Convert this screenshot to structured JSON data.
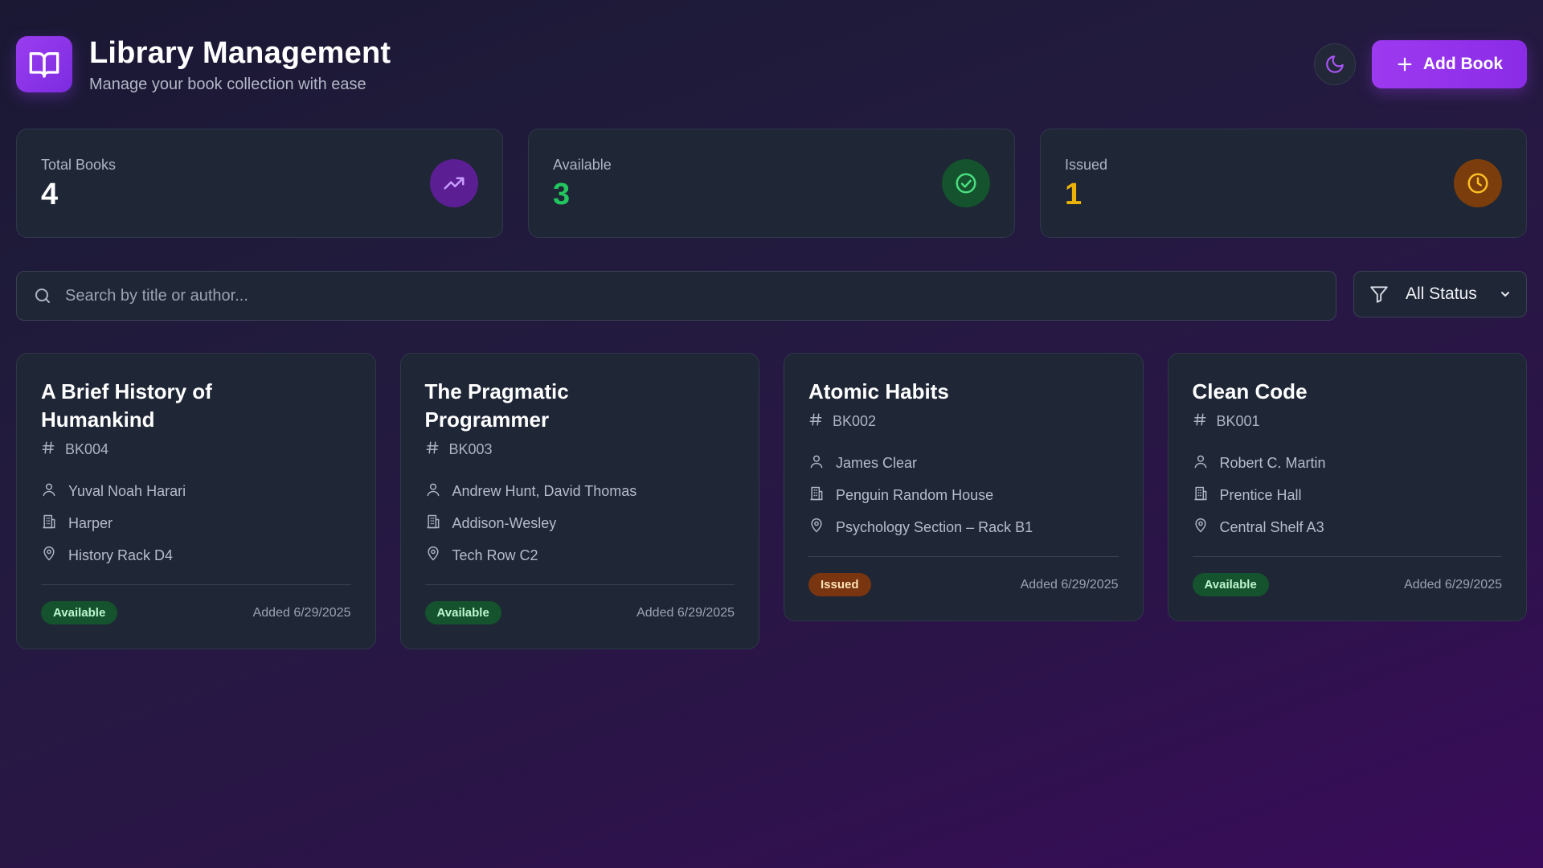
{
  "header": {
    "title": "Library Management",
    "subtitle": "Manage your book collection with ease",
    "add_button_label": "Add Book"
  },
  "stats": [
    {
      "label": "Total Books",
      "value": "4",
      "color": "#ffffff",
      "icon": "trending-up-icon",
      "icon_bg": "#5b1f93",
      "icon_color": "#c89cff"
    },
    {
      "label": "Available",
      "value": "3",
      "color": "#22c55e",
      "icon": "check-circle-icon",
      "icon_bg": "#14532d",
      "icon_color": "#4ade80"
    },
    {
      "label": "Issued",
      "value": "1",
      "color": "#eab308",
      "icon": "clock-icon",
      "icon_bg": "#7c3d0c",
      "icon_color": "#fbbf24"
    }
  ],
  "search": {
    "placeholder": "Search by title or author...",
    "value": ""
  },
  "filter": {
    "selected": "All Status"
  },
  "books": [
    {
      "title": "A Brief History of Humankind",
      "id": "BK004",
      "author": "Yuval Noah Harari",
      "publisher": "Harper",
      "location": "History Rack D4",
      "status": "Available",
      "status_class": "available",
      "added": "Added 6/29/2025"
    },
    {
      "title": "The Pragmatic Programmer",
      "id": "BK003",
      "author": "Andrew Hunt, David Thomas",
      "publisher": "Addison-Wesley",
      "location": "Tech Row C2",
      "status": "Available",
      "status_class": "available",
      "added": "Added 6/29/2025"
    },
    {
      "title": "Atomic Habits",
      "id": "BK002",
      "author": "James Clear",
      "publisher": "Penguin Random House",
      "location": "Psychology Section – Rack B1",
      "status": "Issued",
      "status_class": "issued",
      "added": "Added 6/29/2025"
    },
    {
      "title": "Clean Code",
      "id": "BK001",
      "author": "Robert C. Martin",
      "publisher": "Prentice Hall",
      "location": "Central Shelf A3",
      "status": "Available",
      "status_class": "available",
      "added": "Added 6/29/2025"
    }
  ],
  "colors": {
    "accent": "#8a2be6",
    "card_bg": "#1f2636",
    "available": "#22c55e",
    "issued": "#eab308"
  }
}
